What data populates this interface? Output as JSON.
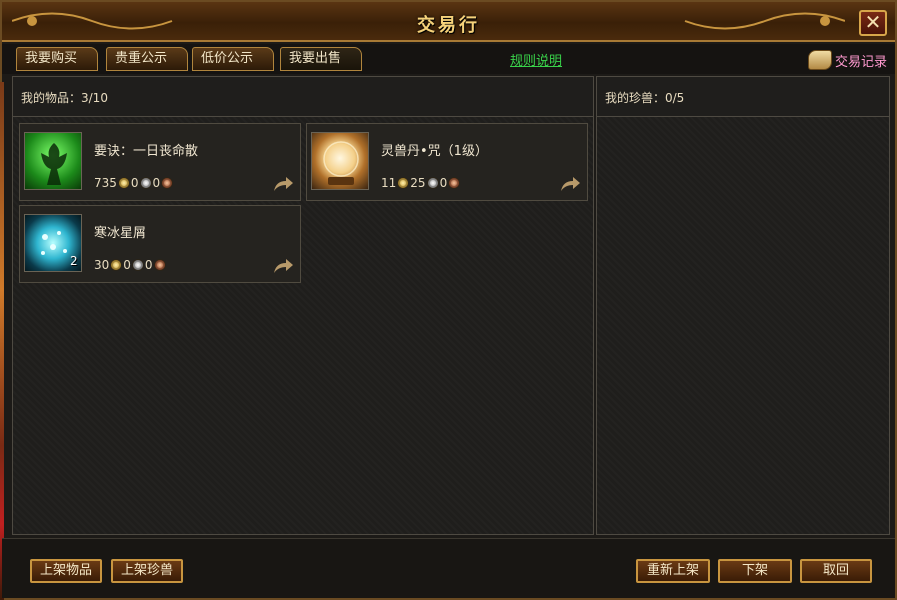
{
  "window": {
    "title": "交易行",
    "close_label": "✕"
  },
  "tabs": [
    {
      "label": "我要购买"
    },
    {
      "label": "贵重公示"
    },
    {
      "label": "低价公示"
    },
    {
      "label": "我要出售"
    }
  ],
  "rules_link": "规则说明",
  "trade_record": {
    "label": "交易记录",
    "icon": "scroll-icon"
  },
  "items_panel": {
    "header": "我的物品：3/10"
  },
  "pets_panel": {
    "header": "我的珍兽：0/5"
  },
  "items": [
    {
      "name": "要诀：一日丧命散",
      "icon": "green-figure-icon",
      "price": {
        "gold": "735",
        "silver": "0",
        "copper": "0"
      },
      "count": ""
    },
    {
      "name": "灵兽丹•咒（1级）",
      "icon": "crystal-orb-icon",
      "price": {
        "gold": "11",
        "silver": "25",
        "copper": "0"
      },
      "count": ""
    },
    {
      "name": "寒冰星屑",
      "icon": "ice-crystal-icon",
      "price": {
        "gold": "30",
        "silver": "0",
        "copper": "0"
      },
      "count": "2"
    }
  ],
  "buttons": {
    "list_item": "上架物品",
    "list_pet": "上架珍兽",
    "relist": "重新上架",
    "delist": "下架",
    "cancel": "取回"
  },
  "colors": {
    "title_gold": "#f6d27a",
    "rules_link_green": "#39d24a",
    "trade_record_pink": "#ff9ad0"
  }
}
